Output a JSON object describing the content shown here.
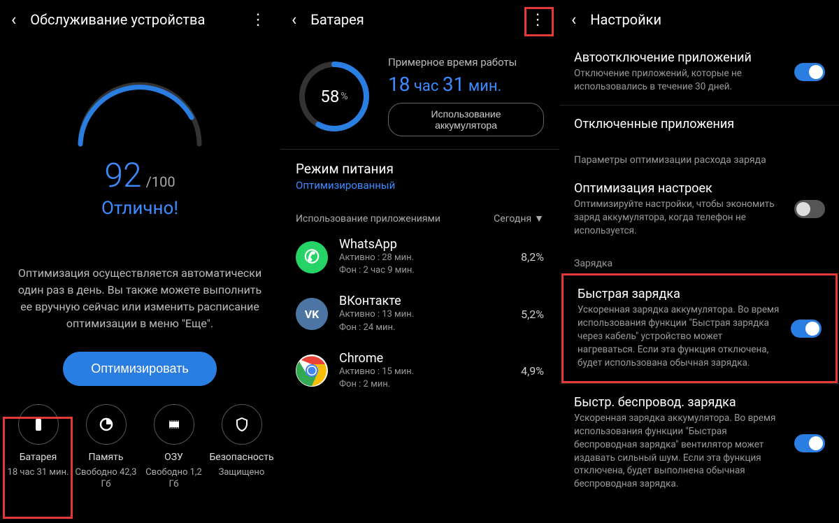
{
  "s1": {
    "title": "Обслуживание устройства",
    "score": "92",
    "score_of": "/100",
    "score_word": "Отлично!",
    "desc": "Оптимизация осуществляется автоматически один раз в день. Вы также можете выполнить ее вручную сейчас или изменить расписание оптимизации в меню \"Еще\".",
    "optimize": "Оптимизировать",
    "bottom": {
      "battery": {
        "label": "Батарея",
        "value": "18 час 31 мин."
      },
      "memory": {
        "label": "Память",
        "value": "Свободно 42,3 Гб"
      },
      "ram": {
        "label": "ОЗУ",
        "value": "Свободно 1,2 Гб"
      },
      "security": {
        "label": "Безопасность",
        "value": "Защищено"
      }
    }
  },
  "s2": {
    "title": "Батарея",
    "percent": "58",
    "est_label": "Примерное время работы",
    "est_h": "18",
    "est_h_u": "час",
    "est_m": "31",
    "est_m_u": "мин.",
    "usage_btn": "Использование аккумулятора",
    "mode_title": "Режим питания",
    "mode_value": "Оптимизированный",
    "apps_label": "Использование приложениями",
    "today": "Сегодня",
    "apps": [
      {
        "name": "WhatsApp",
        "active": "Активно : 28 мин.",
        "bg": "Фон : 2 час 9 мин.",
        "pct": "8,2%",
        "color": "#25D366",
        "glyph": "✆"
      },
      {
        "name": "ВКонтакте",
        "active": "Активно : 13 мин.",
        "bg": "Фон : 24 мин.",
        "pct": "5,2%",
        "color": "#4C75A3",
        "glyph": "VK"
      },
      {
        "name": "Chrome",
        "active": "Активно : 15 мин.",
        "bg": "Фон : 2 мин.",
        "pct": "4,9%",
        "color": "#fff",
        "glyph": "◉"
      }
    ]
  },
  "s3": {
    "title": "Настройки",
    "auto_off": {
      "title": "Автоотключение приложений",
      "desc": "Отключение приложений, которые не использовались в течение 30 дней."
    },
    "disabled_apps": {
      "title": "Отключенные приложения"
    },
    "cat_opt": "Параметры оптимизации расхода заряда",
    "opt_settings": {
      "title": "Оптимизация настроек",
      "desc": "Оптимизируйте настройки, чтобы экономить заряд аккумулятора, когда телефон не используется."
    },
    "cat_charge": "Зарядка",
    "fast": {
      "title": "Быстрая зарядка",
      "desc": "Ускоренная зарядка аккумулятора. Во время использования функции \"Быстрая зарядка через кабель\" устройство может нагреваться. Если эта функция отключена, будет использована обычная зарядка."
    },
    "fast_wireless": {
      "title": "Быстр. беспровод. зарядка",
      "desc": "Ускоренная зарядка аккумулятора. Во время использования функции \"Быстрая беспроводная зарядка\" вентилятор может издавать сильный шум. Если эта функция отключена, будет выполнена обычная беспроводная зарядка."
    }
  }
}
